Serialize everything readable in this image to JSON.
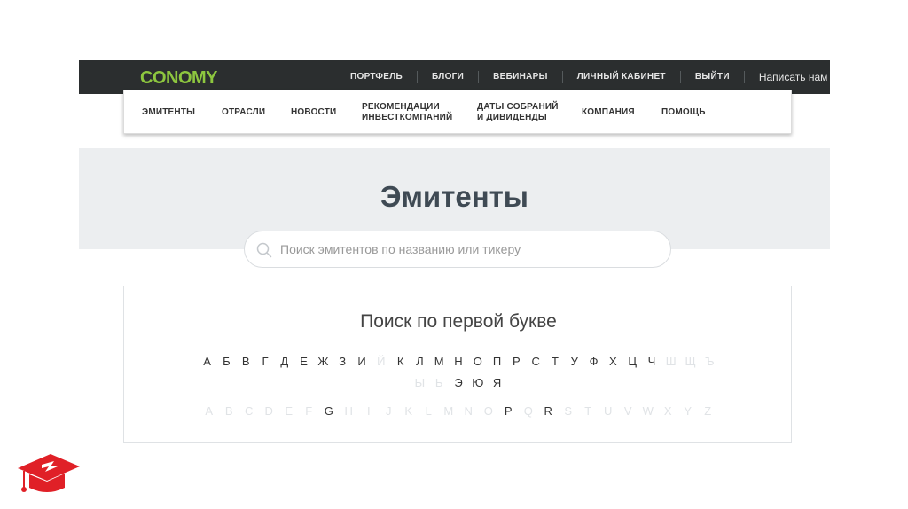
{
  "logo": "CONOMY",
  "topnav": {
    "items": [
      "ПОРТФЕЛЬ",
      "БЛОГИ",
      "ВЕБИНАРЫ",
      "ЛИЧНЫЙ КАБИНЕТ",
      "ВЫЙТИ"
    ],
    "contact": "Написать нам"
  },
  "mainnav": {
    "emitents": "ЭМИТЕНТЫ",
    "sectors": "ОТРАСЛИ",
    "news": "НОВОСТИ",
    "reco_1": "РЕКОМЕНДАЦИИ",
    "reco_2": "ИНВЕСТКОМПАНИЙ",
    "dates_1": "ДАТЫ СОБРАНИЙ",
    "dates_2": "И ДИВИДЕНДЫ",
    "company": "КОМПАНИЯ",
    "help": "ПОМОЩЬ"
  },
  "hero": {
    "title": "Эмитенты"
  },
  "search": {
    "placeholder": "Поиск эмитентов по названию или тикеру",
    "value": ""
  },
  "letters": {
    "title": "Поиск по первой букве",
    "cyrillic_row1": [
      {
        "ch": "А",
        "on": true
      },
      {
        "ch": "Б",
        "on": true
      },
      {
        "ch": "В",
        "on": true
      },
      {
        "ch": "Г",
        "on": true
      },
      {
        "ch": "Д",
        "on": true
      },
      {
        "ch": "Е",
        "on": true
      },
      {
        "ch": "Ж",
        "on": true
      },
      {
        "ch": "З",
        "on": true
      },
      {
        "ch": "И",
        "on": true
      },
      {
        "ch": "Й",
        "on": false
      },
      {
        "ch": "К",
        "on": true
      },
      {
        "ch": "Л",
        "on": true
      },
      {
        "ch": "М",
        "on": true
      },
      {
        "ch": "Н",
        "on": true
      },
      {
        "ch": "О",
        "on": true
      },
      {
        "ch": "П",
        "on": true
      },
      {
        "ch": "Р",
        "on": true
      },
      {
        "ch": "С",
        "on": true
      },
      {
        "ch": "Т",
        "on": true
      },
      {
        "ch": "У",
        "on": true
      },
      {
        "ch": "Ф",
        "on": true
      },
      {
        "ch": "Х",
        "on": true
      },
      {
        "ch": "Ц",
        "on": true
      },
      {
        "ch": "Ч",
        "on": true
      },
      {
        "ch": "Ш",
        "on": false
      },
      {
        "ch": "Щ",
        "on": false
      },
      {
        "ch": "Ъ",
        "on": false
      }
    ],
    "cyrillic_row2": [
      {
        "ch": "Ы",
        "on": false
      },
      {
        "ch": "Ь",
        "on": false
      },
      {
        "ch": "Э",
        "on": true
      },
      {
        "ch": "Ю",
        "on": true
      },
      {
        "ch": "Я",
        "on": true
      }
    ],
    "latin": [
      {
        "ch": "A",
        "on": false
      },
      {
        "ch": "B",
        "on": false
      },
      {
        "ch": "C",
        "on": false
      },
      {
        "ch": "D",
        "on": false
      },
      {
        "ch": "E",
        "on": false
      },
      {
        "ch": "F",
        "on": false
      },
      {
        "ch": "G",
        "on": true
      },
      {
        "ch": "H",
        "on": false
      },
      {
        "ch": "I",
        "on": false
      },
      {
        "ch": "J",
        "on": false
      },
      {
        "ch": "K",
        "on": false
      },
      {
        "ch": "L",
        "on": false
      },
      {
        "ch": "M",
        "on": false
      },
      {
        "ch": "N",
        "on": false
      },
      {
        "ch": "O",
        "on": false
      },
      {
        "ch": "P",
        "on": true
      },
      {
        "ch": "Q",
        "on": false
      },
      {
        "ch": "R",
        "on": true
      },
      {
        "ch": "S",
        "on": false
      },
      {
        "ch": "T",
        "on": false
      },
      {
        "ch": "U",
        "on": false
      },
      {
        "ch": "V",
        "on": false
      },
      {
        "ch": "W",
        "on": false
      },
      {
        "ch": "X",
        "on": false
      },
      {
        "ch": "Y",
        "on": false
      },
      {
        "ch": "Z",
        "on": false
      }
    ]
  },
  "colors": {
    "brand": "#8dc63f",
    "topbar": "#2b2e2f",
    "cap_red": "#e02027"
  }
}
